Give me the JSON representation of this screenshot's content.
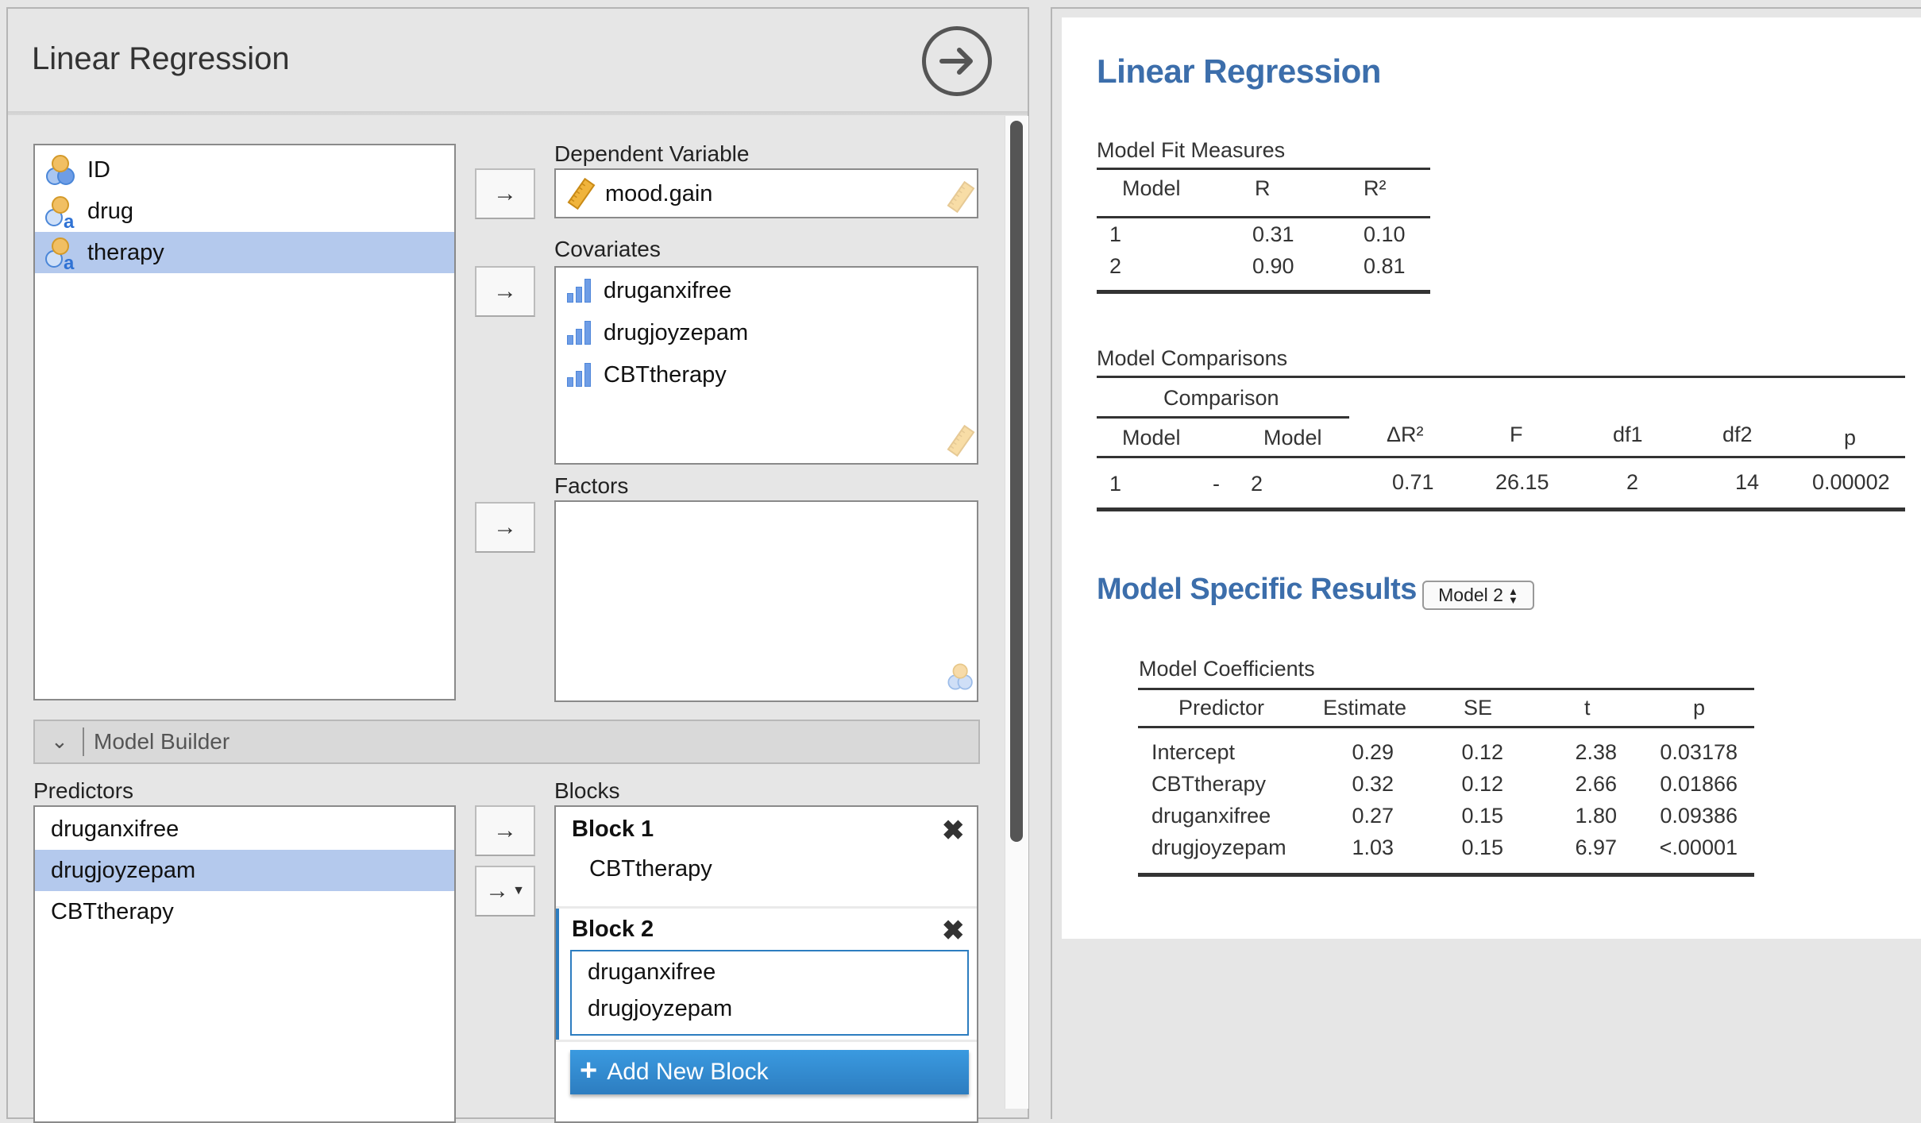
{
  "analysis": {
    "title": "Linear Regression",
    "run_icon": "arrow-circle-right-icon",
    "variables": [
      {
        "name": "ID",
        "icon": "id-variable-icon",
        "selected": false
      },
      {
        "name": "drug",
        "icon": "nominal-text-variable-icon",
        "selected": false
      },
      {
        "name": "therapy",
        "icon": "nominal-text-variable-icon",
        "selected": true
      }
    ],
    "dependent": {
      "label": "Dependent Variable",
      "value": "mood.gain",
      "icon": "continuous-ruler-icon"
    },
    "covariates": {
      "label": "Covariates",
      "items": [
        "druganxifree",
        "drugjoyzepam",
        "CBTtherapy"
      ],
      "hint_icon": "continuous-ruler-icon"
    },
    "factors": {
      "label": "Factors",
      "items": [],
      "hint_icon": "nominal-variable-icon"
    },
    "model_builder": {
      "label": "Model Builder",
      "expanded": true
    },
    "predictors": {
      "label": "Predictors",
      "items": [
        {
          "name": "druganxifree",
          "selected": false
        },
        {
          "name": "drugjoyzepam",
          "selected": true
        },
        {
          "name": "CBTtherapy",
          "selected": false
        }
      ]
    },
    "blocks": {
      "label": "Blocks",
      "items": [
        {
          "title": "Block 1",
          "terms": [
            "CBTtherapy"
          ]
        },
        {
          "title": "Block 2",
          "terms": [
            "druganxifree",
            "drugjoyzepam"
          ],
          "active": true
        }
      ],
      "add_label": "Add New Block"
    },
    "arrow_glyph": "→"
  },
  "results": {
    "title": "Linear Regression",
    "fit": {
      "title": "Model Fit Measures",
      "columns": [
        "Model",
        "R",
        "R²"
      ],
      "rows": [
        [
          "1",
          "0.31",
          "0.10"
        ],
        [
          "2",
          "0.90",
          "0.81"
        ]
      ]
    },
    "comparisons": {
      "title": "Model Comparisons",
      "group_header": "Comparison",
      "columns": [
        "Model",
        "Model",
        "ΔR²",
        "F",
        "df1",
        "df2",
        "p"
      ],
      "rows": [
        [
          "1",
          "-",
          "2",
          "0.71",
          "26.15",
          "2",
          "14",
          "0.00002"
        ]
      ]
    },
    "specific": {
      "title": "Model Specific Results",
      "selected_model": "Model 2",
      "coefficients": {
        "title": "Model Coefficients",
        "columns": [
          "Predictor",
          "Estimate",
          "SE",
          "t",
          "p"
        ],
        "rows": [
          [
            "Intercept",
            "0.29",
            "0.12",
            "2.38",
            "0.03178"
          ],
          [
            "CBTtherapy",
            "0.32",
            "0.12",
            "2.66",
            "0.01866"
          ],
          [
            "druganxifree",
            "0.27",
            "0.15",
            "1.80",
            "0.09386"
          ],
          [
            "drugjoyzepam",
            "1.03",
            "0.15",
            "6.97",
            "<.00001"
          ]
        ]
      }
    }
  },
  "colors": {
    "accent": "#3c6eab",
    "selection": "#b4c9ed",
    "button_blue": "#3a9ae0"
  }
}
